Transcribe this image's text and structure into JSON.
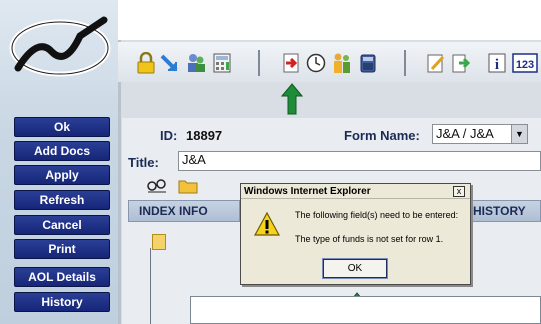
{
  "sidebar": {
    "buttons": [
      {
        "label": "Ok"
      },
      {
        "label": "Add Docs"
      },
      {
        "label": "Apply"
      },
      {
        "label": "Refresh"
      },
      {
        "label": "Cancel"
      },
      {
        "label": "Print"
      },
      {
        "label": "AOL Details"
      },
      {
        "label": "History"
      }
    ]
  },
  "toolbar": {
    "icons": [
      "lock-icon",
      "arrow-link-icon",
      "users-icon",
      "calculator-icon",
      "forward-doc-icon",
      "clock-icon",
      "people-icon",
      "phone-icon",
      "edit-doc-icon",
      "doc-arrow-icon",
      "info-icon",
      "numbering-icon"
    ]
  },
  "form": {
    "id_label": "ID:",
    "id_value": "18897",
    "form_name_label": "Form Name:",
    "form_name_value": "J&A / J&A",
    "title_label": "Title:",
    "title_value": "J&A"
  },
  "tabs": {
    "index_info": "INDEX INFO",
    "history": "HISTORY"
  },
  "dialog": {
    "title": "Windows Internet Explorer",
    "close": "x",
    "line1": "The following field(s) need to be entered:",
    "line2": "The type of funds is not set for row 1.",
    "ok_label": "OK"
  },
  "colors": {
    "sidebar_button": "#1c2d85",
    "arrow": "#1f8c3a",
    "dialog_bg": "#ece9d8"
  }
}
